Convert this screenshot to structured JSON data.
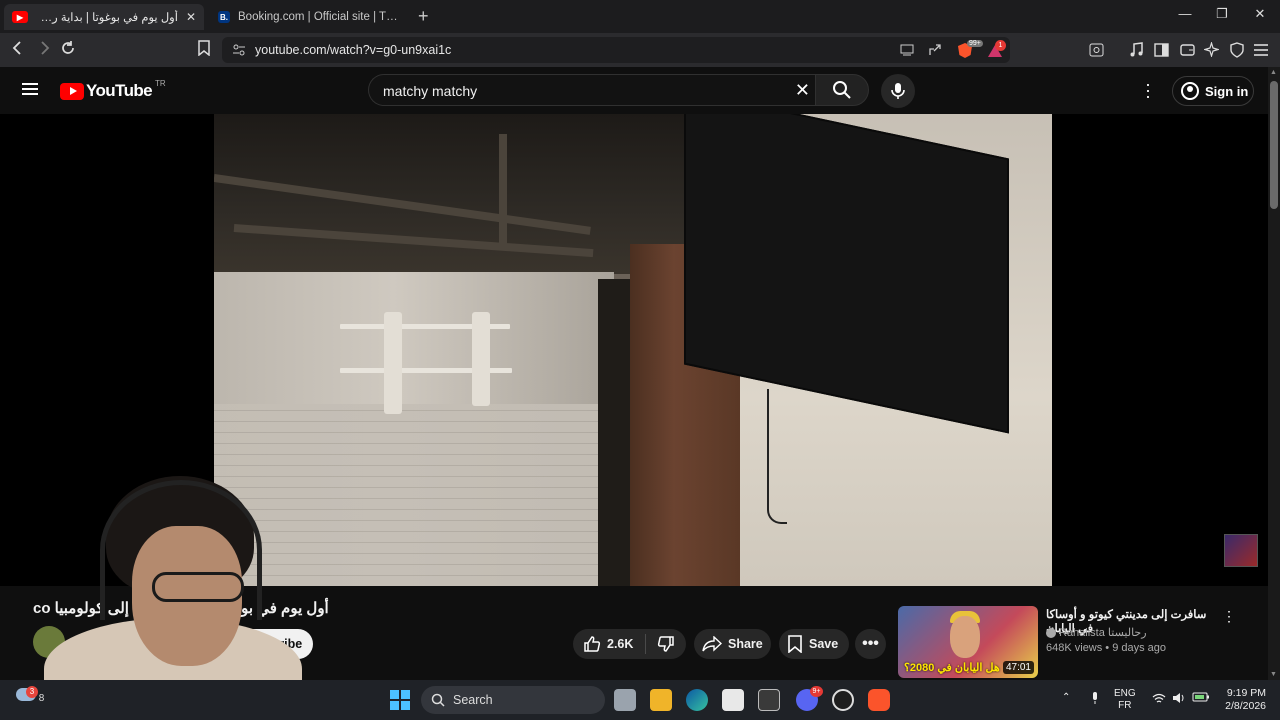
{
  "browser": {
    "tabs": [
      {
        "title": "أول يوم في بوغوتا | بداية رحلتي إلى",
        "favicon": "youtube-favicon",
        "active": true
      },
      {
        "title": "Booking.com | Official site | The best",
        "favicon": "booking-favicon",
        "favicon_letter": "B.",
        "active": false
      }
    ],
    "new_tab_icon": "+",
    "window_controls": {
      "minimize": "—",
      "restore": "❐",
      "close": "✕"
    },
    "address": "youtube.com/watch?v=g0-un9xai1c",
    "shields_badge": "99+",
    "rewards_badge": "1"
  },
  "youtube": {
    "logo_text": "YouTube",
    "region": "TR",
    "search": {
      "query": "matchy matchy"
    },
    "sign_in_label": "Sign in",
    "video": {
      "title": "أول يوم في بوغوتا | بداية رحلتي إلى كولومبيا co",
      "subscribe_label": "Subscribe",
      "likes": "2.6K",
      "share_label": "Share",
      "save_label": "Save"
    },
    "related": {
      "title": "سافرت إلى مدينتي كيوتو و أوساكا في اليابان",
      "channel": "Rahalista رحاليستا",
      "meta": "648K views • 9 days ago",
      "duration": "47:01",
      "thumbnail_text": "هل اليابان في 2080؟"
    }
  },
  "taskbar": {
    "weather_badge": "3",
    "weather_text": "8",
    "search_label": "Search",
    "discord_badge": "9+",
    "language": "ENG",
    "layout": "FR",
    "time": "9:19 PM",
    "date": "2/8/2026"
  },
  "colors": {
    "youtube_red": "#ff0000",
    "brave_orange": "#fb542b",
    "windows_blue": "#4cc2ff"
  }
}
